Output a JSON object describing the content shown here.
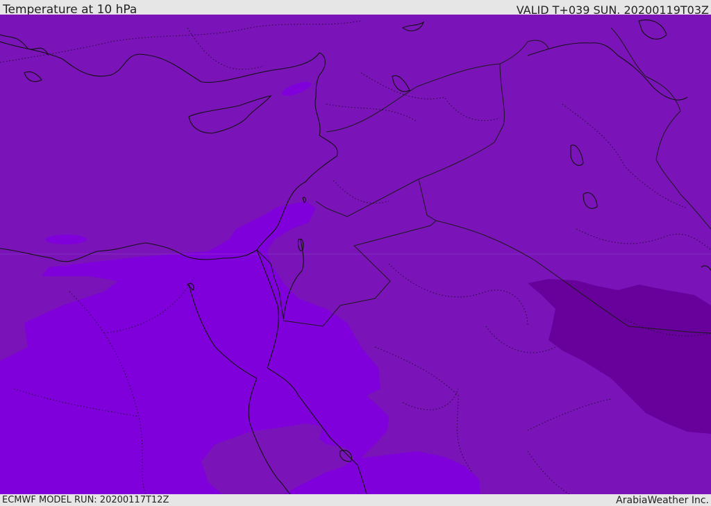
{
  "header": {
    "title": "Temperature at 10 hPa",
    "valid": "VALID T+039 SUN. 20200119T03Z"
  },
  "footer": {
    "model_run": "ECMWF MODEL RUN: 20200117T12Z",
    "credit": "ArabiaWeather Inc."
  },
  "map": {
    "colors": {
      "base": "#7a13b8",
      "cold": "#8000dc",
      "warm_core": "#68009c",
      "coastline": "#111111",
      "border": "#1a1a1a"
    }
  }
}
